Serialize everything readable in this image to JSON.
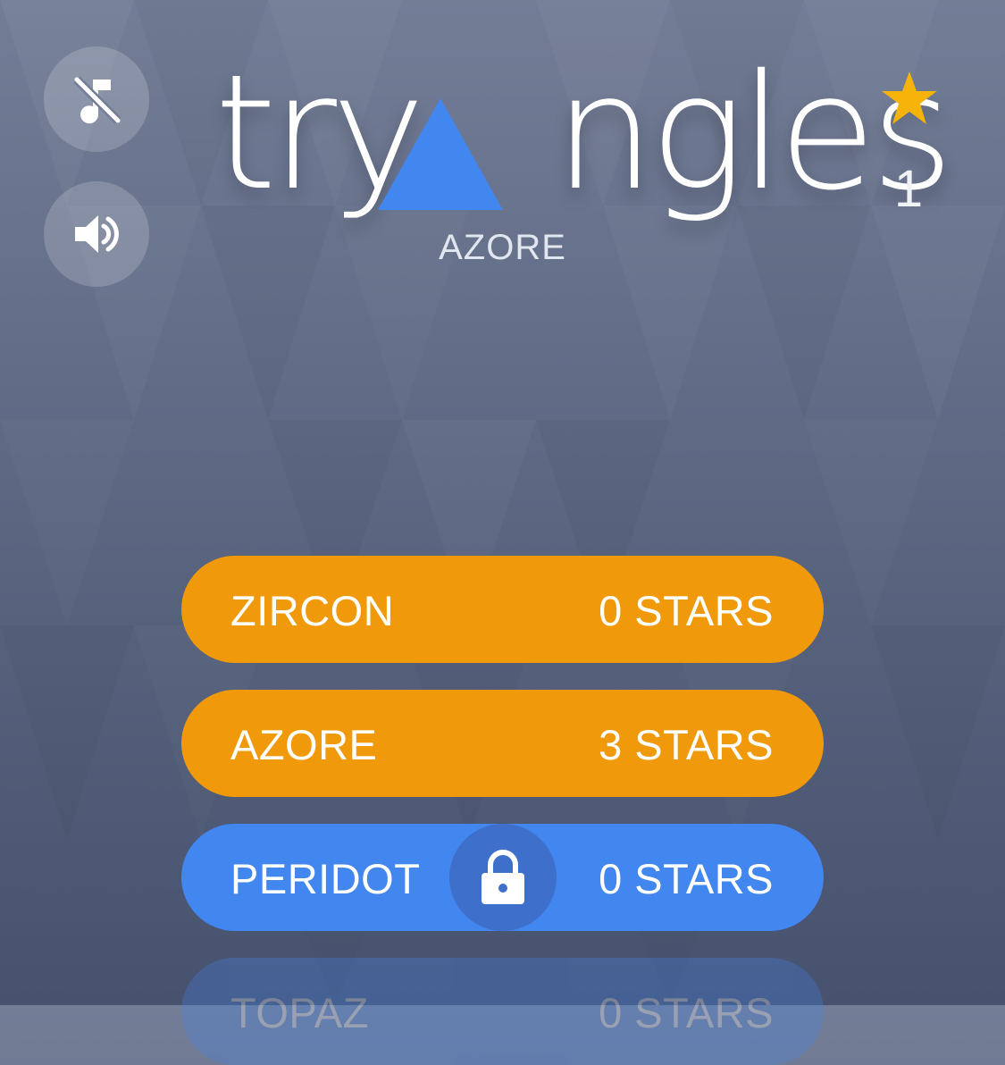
{
  "header": {
    "title": "tryangles",
    "title_left": "try",
    "title_right": "ngles",
    "subtitle": "AZORE",
    "star_count": "1"
  },
  "controls": {
    "music_icon": "music-off-icon",
    "sound_icon": "speaker-icon"
  },
  "worlds": [
    {
      "name": "ZIRCON",
      "stars": "0 STARS",
      "state": "unlocked",
      "color": "#f0990a"
    },
    {
      "name": "AZORE",
      "stars": "3 STARS",
      "state": "unlocked",
      "color": "#f0990a"
    },
    {
      "name": "PERIDOT",
      "stars": "0 STARS",
      "state": "locked",
      "color": "#4286ef"
    },
    {
      "name": "TOPAZ",
      "stars": "0 STARS",
      "state": "locked",
      "color": "#4286ef"
    }
  ],
  "colors": {
    "accent_orange": "#f0990a",
    "accent_blue": "#4286ef",
    "star_gold": "#f6b40a"
  }
}
